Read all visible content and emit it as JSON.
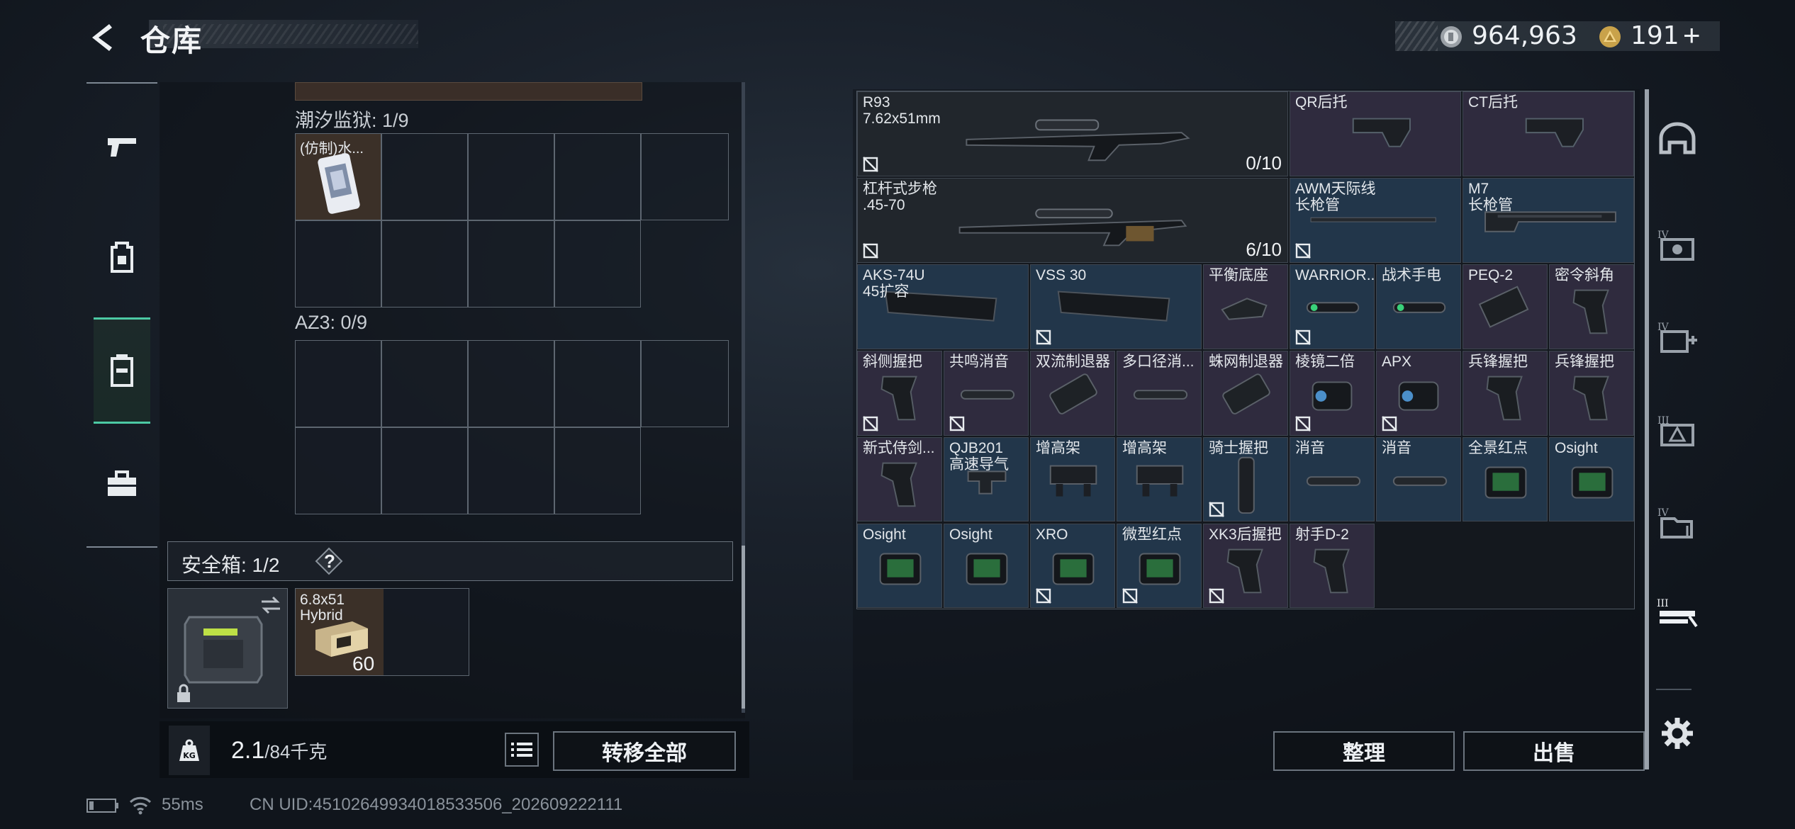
{
  "header": {
    "title": "仓库",
    "coins": "964,963",
    "tokens": "191",
    "add_symbol": "+"
  },
  "sidebar": {
    "items": [
      {
        "icon": "pistol-icon",
        "label": ""
      },
      {
        "icon": "backpack-icon",
        "label": ""
      },
      {
        "icon": "storage-icon",
        "label": "",
        "active": true
      },
      {
        "icon": "toolbox-icon",
        "label": ""
      }
    ]
  },
  "storage": {
    "sections": [
      {
        "label": "潮汐监狱: 1/9",
        "item": "(仿制)水..."
      },
      {
        "label": "AZ3: 0/9"
      }
    ],
    "safe_box": {
      "label": "安全箱: 1/2",
      "help": "?",
      "ammo_name": "6.8x51",
      "ammo_sub": "Hybrid",
      "ammo_count": "60"
    },
    "weight": {
      "current": "2.1",
      "max": "/84千克"
    },
    "transfer_all": "转移全部",
    "kg_label": "KG"
  },
  "grid": {
    "items": [
      {
        "l1": "R93",
        "l2": "7.62x51mm",
        "count": "0/10"
      },
      {
        "l1": "QR后托",
        "l2": ""
      },
      {
        "l1": "CT后托",
        "l2": ""
      },
      {
        "l1": "杠杆式步枪",
        "l2": ".45-70",
        "count": "6/10"
      },
      {
        "l1": "AWM天际线",
        "l2": "长枪管"
      },
      {
        "l1": "M7",
        "l2": "长枪管"
      },
      {
        "l1": "AKS-74U",
        "l2": "45扩容"
      },
      {
        "l1": "VSS 30",
        "l2": ""
      },
      {
        "l1": "平衡底座",
        "l2": ""
      },
      {
        "l1": "WARRIOR...",
        "l2": ""
      },
      {
        "l1": "战术手电",
        "l2": ""
      },
      {
        "l1": "PEQ-2",
        "l2": ""
      },
      {
        "l1": "密令斜角",
        "l2": ""
      },
      {
        "l1": "斜侧握把",
        "l2": ""
      },
      {
        "l1": "共鸣消音",
        "l2": ""
      },
      {
        "l1": "双流制退器",
        "l2": ""
      },
      {
        "l1": "多口径消...",
        "l2": ""
      },
      {
        "l1": "蛛网制退器",
        "l2": ""
      },
      {
        "l1": "棱镜二倍",
        "l2": ""
      },
      {
        "l1": "APX",
        "l2": ""
      },
      {
        "l1": "兵锋握把",
        "l2": ""
      },
      {
        "l1": "兵锋握把",
        "l2": ""
      },
      {
        "l1": "新式侍剑...",
        "l2": ""
      },
      {
        "l1": "QJB201",
        "l2": "高速导气"
      },
      {
        "l1": "增高架",
        "l2": ""
      },
      {
        "l1": "增高架",
        "l2": ""
      },
      {
        "l1": "骑士握把",
        "l2": ""
      },
      {
        "l1": "消音",
        "l2": ""
      },
      {
        "l1": "消音",
        "l2": ""
      },
      {
        "l1": "全景红点",
        "l2": ""
      },
      {
        "l1": "Osight",
        "l2": ""
      },
      {
        "l1": "Osight",
        "l2": ""
      },
      {
        "l1": "Osight",
        "l2": ""
      },
      {
        "l1": "XRO",
        "l2": ""
      },
      {
        "l1": "微型红点",
        "l2": ""
      },
      {
        "l1": "XK3后握把",
        "l2": ""
      },
      {
        "l1": "射手D-2",
        "l2": ""
      }
    ]
  },
  "actions": {
    "organize": "整理",
    "sell": "出售"
  },
  "right_icons": [
    "helmet-icon",
    "armor-box-icon",
    "medkit-box-icon",
    "equipment-box-icon",
    "container-box-icon",
    "weapon-rack-icon"
  ],
  "status_bar": {
    "ping": "55ms",
    "uid": "CN UID:45102649934018533506_202609222111"
  },
  "colors": {
    "accent": "#4cc9a4",
    "purple_tier": "#2f2b3e",
    "blue_tier": "#22364a",
    "dark_tier": "#21262c"
  }
}
